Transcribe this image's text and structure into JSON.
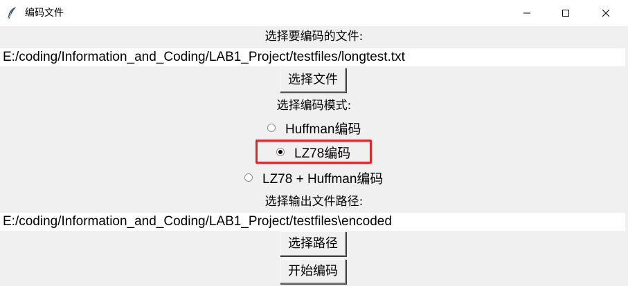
{
  "window": {
    "title": "编码文件",
    "controls": {
      "minimize": "minimize-icon",
      "maximize": "maximize-icon",
      "close": "close-icon"
    }
  },
  "input_section": {
    "label": "选择要编码的文件:",
    "path_value": "E:/coding/Information_and_Coding/LAB1_Project/testfiles/longtest.txt",
    "browse_button": "选择文件"
  },
  "mode_section": {
    "label": "选择编码模式:",
    "options": [
      {
        "label": "Huffman编码",
        "checked": false
      },
      {
        "label": "LZ78编码",
        "checked": true
      },
      {
        "label": "LZ78 + Huffman编码",
        "checked": false
      }
    ],
    "highlight_color": "#e8232b"
  },
  "output_section": {
    "label": "选择输出文件路径:",
    "path_value": "E:/coding/Information_and_Coding/LAB1_Project/testfiles\\encoded",
    "browse_button": "选择路径"
  },
  "actions": {
    "start_button": "开始编码"
  }
}
